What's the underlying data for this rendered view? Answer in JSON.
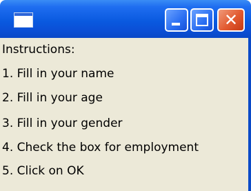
{
  "window": {
    "title": "",
    "controls": {
      "minimize_icon": "minimize-icon",
      "maximize_icon": "maximize-icon",
      "close_icon": "close-icon",
      "close_glyph": "✕"
    }
  },
  "instructions": {
    "heading": "Instructions:",
    "steps": [
      "1. Fill in your name",
      "2. Fill in your age",
      "3. Fill in your gender",
      "4. Check the box for employment",
      "5. Click on OK"
    ]
  },
  "colors": {
    "titlebar": "#0a5ae0",
    "client_background": "#ece9d8",
    "close_button": "#e25a30"
  }
}
